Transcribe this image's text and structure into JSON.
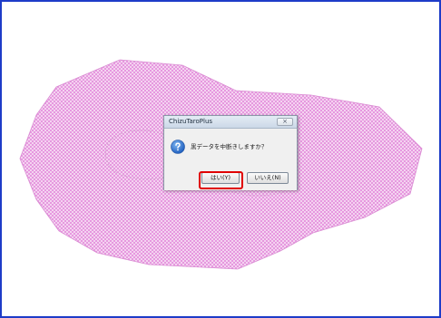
{
  "dialog": {
    "title": "ChizuTaroPlus",
    "close_icon": "×",
    "icon": "question-icon",
    "message": "黒データを中断きしますか？",
    "yes_label": "はい(Y)",
    "no_label": "いいえ(N)"
  },
  "colors": {
    "frame_border": "#1e3cc8",
    "polygon_fill": "#e89be3",
    "highlight": "#e00000"
  }
}
